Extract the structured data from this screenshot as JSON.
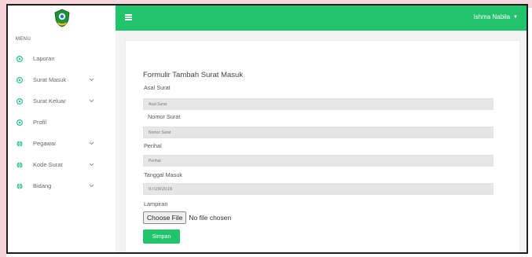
{
  "colors": {
    "accent": "#21c36c",
    "sidebar_icon": "#2bbf8a",
    "input_bg": "#e6e6e6"
  },
  "sidebar": {
    "menu_heading": "MENU",
    "items": [
      {
        "label": "Laporan",
        "icon": "settings-icon",
        "has_chevron": false
      },
      {
        "label": "Surat Masuk",
        "icon": "settings-icon",
        "has_chevron": true
      },
      {
        "label": "Surat Keluar",
        "icon": "settings-icon",
        "has_chevron": true
      },
      {
        "label": "Profil",
        "icon": "settings-icon",
        "has_chevron": false
      },
      {
        "label": "Pegawai",
        "icon": "globe-icon",
        "has_chevron": true
      },
      {
        "label": "Kode Surat",
        "icon": "globe-icon",
        "has_chevron": true
      },
      {
        "label": "Bidang",
        "icon": "globe-icon",
        "has_chevron": true
      }
    ]
  },
  "header": {
    "user_name": "Ishma Nabila",
    "user_caret": "▼"
  },
  "form": {
    "title": "Formulir Tambah Surat Masuk",
    "asal_label": "Asal Surat",
    "asal_placeholder": "Asal Surat",
    "nomor_label": "Nomor Surat",
    "nomor_placeholder": "Nomor Surat",
    "perihal_label": "Perihal",
    "perihal_placeholder": "Perihal",
    "tanggal_label": "Tanggal Masuk",
    "tanggal_value": "07/29/2019",
    "lampiran_label": "Lampiran",
    "file_button": "Choose File",
    "file_status": "No file chosen",
    "save_label": "Simpan"
  }
}
